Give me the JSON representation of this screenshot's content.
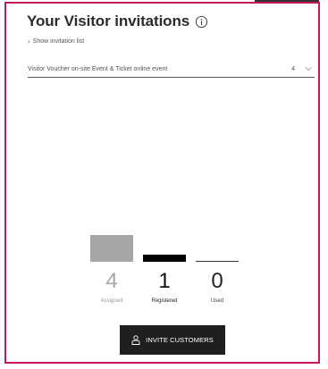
{
  "header": {
    "title": "Your Visitor invitations"
  },
  "show_list_link": {
    "label": "Show invitation list"
  },
  "selector": {
    "text": "Visitor Voucher on-site Event & Ticket online event",
    "value": "4"
  },
  "stats": {
    "assigned": {
      "value": "4",
      "label": "Assigned"
    },
    "registered": {
      "value": "1",
      "label": "Registered"
    },
    "used": {
      "value": "0",
      "label": "Used"
    }
  },
  "invite_button": {
    "label": "INVITE CUSTOMERS"
  },
  "colors": {
    "card_border": "#c0185d",
    "button_bg": "#1f1f1f",
    "assigned_bar": "#a6a6a6"
  },
  "icons": [
    "info-icon",
    "chevron-right-icon",
    "chevron-down-icon",
    "user-icon"
  ]
}
